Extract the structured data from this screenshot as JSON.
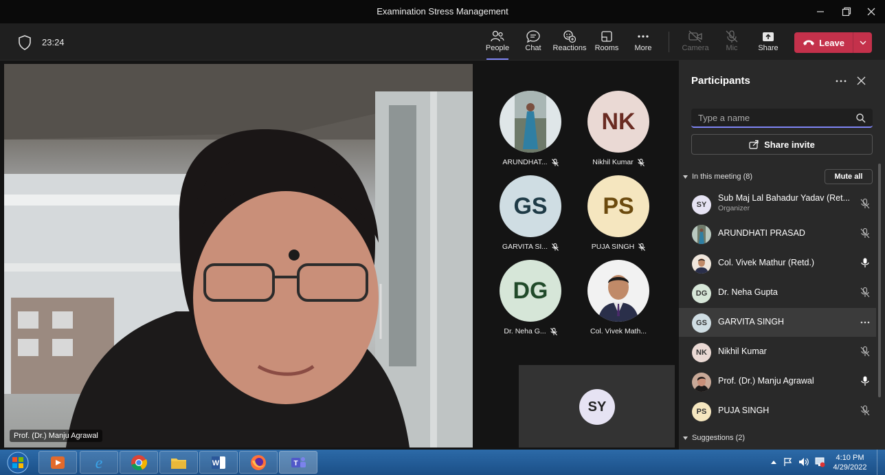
{
  "window": {
    "title": "Examination Stress Management"
  },
  "toolbar": {
    "timer": "23:24",
    "buttons": [
      {
        "label": "People",
        "icon": "people-icon",
        "active": true
      },
      {
        "label": "Chat",
        "icon": "chat-icon"
      },
      {
        "label": "Reactions",
        "icon": "reactions-icon"
      },
      {
        "label": "Rooms",
        "icon": "rooms-icon"
      },
      {
        "label": "More",
        "icon": "more-icon"
      },
      {
        "label": "Camera",
        "icon": "camera-off-icon",
        "disabled": true
      },
      {
        "label": "Mic",
        "icon": "mic-off-icon",
        "disabled": true
      },
      {
        "label": "Share",
        "icon": "share-icon"
      }
    ],
    "leave_label": "Leave"
  },
  "main_video": {
    "speaker_name": "Prof. (Dr.) Manju Agrawal"
  },
  "gallery": [
    {
      "label": "ARUNDHAT...",
      "initials": "",
      "photo": true,
      "bg": "#dfe6e8"
    },
    {
      "label": "Nikhil Kumar",
      "initials": "NK",
      "bg": "#ead9d4",
      "fg": "#6a2b22"
    },
    {
      "label": "GARVITA SI...",
      "initials": "GS",
      "bg": "#cfdde3",
      "fg": "#1e3a46"
    },
    {
      "label": "PUJA SINGH",
      "initials": "PS",
      "bg": "#f5e6bf",
      "fg": "#6b4a0e"
    },
    {
      "label": "Dr. Neha G...",
      "initials": "DG",
      "bg": "#d6e6d8",
      "fg": "#214a2a"
    },
    {
      "label": "Col. Vivek Math...",
      "initials": "",
      "photo": true,
      "bg": "#f2f2f2"
    }
  ],
  "self_tile": {
    "initials": "SY"
  },
  "participants_panel": {
    "title": "Participants",
    "search_placeholder": "Type a name",
    "share_invite_label": "Share invite",
    "in_meeting_label": "In this meeting (8)",
    "mute_all_label": "Mute all",
    "suggestions_label": "Suggestions (2)",
    "people": [
      {
        "name": "Sub Maj Lal Bahadur Yadav (Ret...",
        "role": "Organizer",
        "initials": "SY",
        "bg": "#e6e3f3",
        "mic": "muted"
      },
      {
        "name": "ARUNDHATI PRASAD",
        "initials": "",
        "photo": true,
        "bg": "#b9c9c0",
        "mic": "muted"
      },
      {
        "name": "Col. Vivek Mathur (Retd.)",
        "initials": "",
        "photo": true,
        "bg": "#efe6dc",
        "mic": "on"
      },
      {
        "name": "Dr. Neha Gupta",
        "initials": "DG",
        "bg": "#d6e6d8",
        "mic": "muted"
      },
      {
        "name": "GARVITA SINGH",
        "initials": "GS",
        "bg": "#cfdde3",
        "mic": "more",
        "highlighted": true
      },
      {
        "name": "Nikhil Kumar",
        "initials": "NK",
        "bg": "#ead9d4",
        "mic": "muted"
      },
      {
        "name": "Prof. (Dr.) Manju Agrawal",
        "initials": "",
        "photo": true,
        "bg": "#c8a998",
        "mic": "on"
      },
      {
        "name": "PUJA SINGH",
        "initials": "PS",
        "bg": "#f5e6bf",
        "mic": "muted"
      }
    ]
  },
  "taskbar": {
    "apps": [
      "media-player-icon",
      "internet-explorer-icon",
      "chrome-icon",
      "file-explorer-icon",
      "word-icon",
      "firefox-icon",
      "teams-icon"
    ],
    "time": "4:10 PM",
    "date": "4/29/2022"
  }
}
